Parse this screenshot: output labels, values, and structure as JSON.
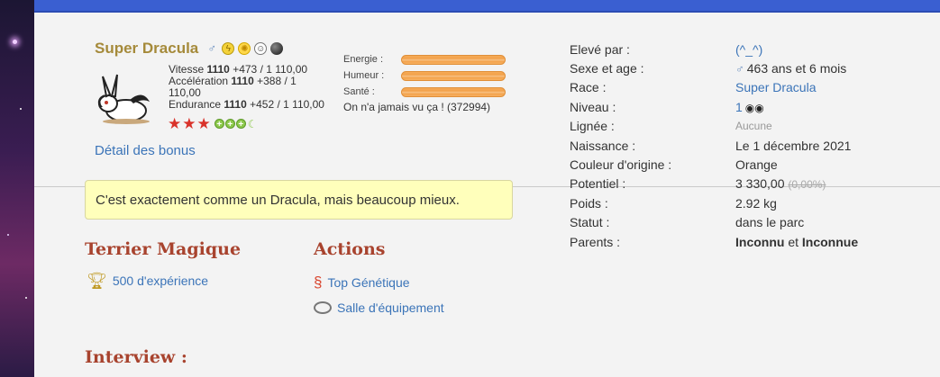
{
  "hero": {
    "name": "Super Dracula",
    "stats": {
      "vitesse": {
        "label": "Vitesse",
        "value": "1110",
        "bonus": "+473",
        "max": "/ 1 110,00"
      },
      "acceleration": {
        "label": "Accélération",
        "value": "1110",
        "bonus": "+388",
        "max": "/ 1 110,00"
      },
      "endurance": {
        "label": "Endurance",
        "value": "1110",
        "bonus": "+452",
        "max": "/ 1 110,00"
      }
    },
    "bars": [
      {
        "label": "Energie :",
        "level": 1.0
      },
      {
        "label": "Humeur :",
        "level": 1.0
      },
      {
        "label": "Santé :",
        "level": 1.0
      }
    ],
    "reputation": "On n'a jamais vu ça ! (372994)",
    "stars": 3,
    "bonus_link": "Détail des bonus"
  },
  "quote": "C'est exactement comme un Dracula, mais beaucoup mieux.",
  "terrier": {
    "title": "Terrier Magique",
    "xp": "500 d'expérience"
  },
  "actions": {
    "title": "Actions",
    "top_genetique": "Top Génétique",
    "salle": "Salle d'équipement"
  },
  "interview": {
    "title": "Interview :"
  },
  "info": {
    "eleve_par": {
      "label": "Elevé par :",
      "value": "(^_^)"
    },
    "sexe_age": {
      "label": "Sexe et age :",
      "value": "463 ans et 6 mois"
    },
    "race": {
      "label": "Race :",
      "value": "Super Dracula"
    },
    "niveau": {
      "label": "Niveau :",
      "value": "1"
    },
    "lignee": {
      "label": "Lignée :",
      "value": "Aucune"
    },
    "naissance": {
      "label": "Naissance :",
      "value": "Le 1 décembre 2021"
    },
    "couleur": {
      "label": "Couleur d'origine :",
      "value": "Orange"
    },
    "potentiel": {
      "label": "Potentiel :",
      "value": "3 330,00",
      "extra": "(0,00%)"
    },
    "poids": {
      "label": "Poids :",
      "value": "2.92 kg"
    },
    "statut": {
      "label": "Statut :",
      "value": "dans le parc"
    },
    "parents": {
      "label": "Parents :",
      "father": "Inconnu",
      "sep": "et",
      "mother": "Inconnue"
    }
  },
  "colors": {
    "accent": "#3b74b8",
    "title": "#a8432e",
    "name": "#a58a3a",
    "topbar": "#3a5fd1"
  }
}
